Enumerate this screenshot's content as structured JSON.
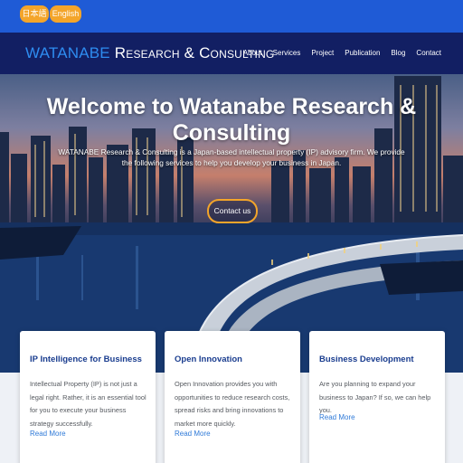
{
  "lang_bar": {
    "japanese_label": "日本語",
    "english_label": "English"
  },
  "header": {
    "brand_part1": "WATANABE",
    "brand_part2": "Research & Consulting",
    "nav": [
      "About",
      "Services",
      "Project",
      "Publication",
      "Blog",
      "Contact"
    ]
  },
  "hero": {
    "title": "Welcome to Watanabe Research & Consulting",
    "description": "WATANABE Research & Consulting is a Japan-based intellectual property (IP) advisory firm. We provide the following services to help you develop your business in Japan.",
    "contact_label": "Contact us"
  },
  "cards": [
    {
      "title": "IP Intelligence for Business",
      "text": "Intellectual Property (IP) is not just a legal right. Rather, it is an essential tool for you to execute your business strategy successfully.",
      "link": "Read More"
    },
    {
      "title": "Open Innovation",
      "text": "Open Innovation provides you with opportunities to reduce research costs, spread risks and bring innovations to market more quickly.",
      "link": "Read More"
    },
    {
      "title": "Business Development",
      "text": "Are you planning to expand your business to Japan? If so, we can help you.",
      "link": "Read More"
    }
  ],
  "colors": {
    "lang_bar": "#1f5bd6",
    "header": "#121f63",
    "accent_orange": "#f4a52a",
    "card_title": "#1a3d8f",
    "link": "#2f7ad8"
  }
}
